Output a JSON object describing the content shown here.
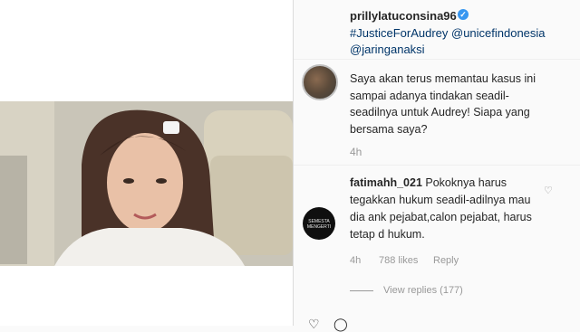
{
  "post": {
    "username": "prillylatuconsina96",
    "tags_line1": "#JusticeForAudrey @unicefindonesia",
    "tags_line2": "@jaringanaksi",
    "caption": "Saya akan terus memantau kasus ini sampai adanya tindakan seadil-seadilnya untuk Audrey! Siapa yang bersama saya?",
    "caption_time": "4h"
  },
  "comment": {
    "username": "fatimahh_021",
    "text": "Pokoknya harus tegakkan hukum seadil-adilnya mau dia ank pejabat,calon pejabat, harus tetap d hukum.",
    "time": "4h",
    "likes": "788 likes",
    "reply_label": "Reply",
    "view_replies": "View replies (177)",
    "avatar_text": "SEMESTA MENGERTI"
  },
  "icons": {
    "verified": "verified-badge-icon",
    "heart": "heart-outline-icon",
    "like": "like-icon",
    "comment": "comment-icon"
  },
  "colors": {
    "link": "#003569",
    "verified": "#3897f0",
    "muted": "#999999"
  }
}
